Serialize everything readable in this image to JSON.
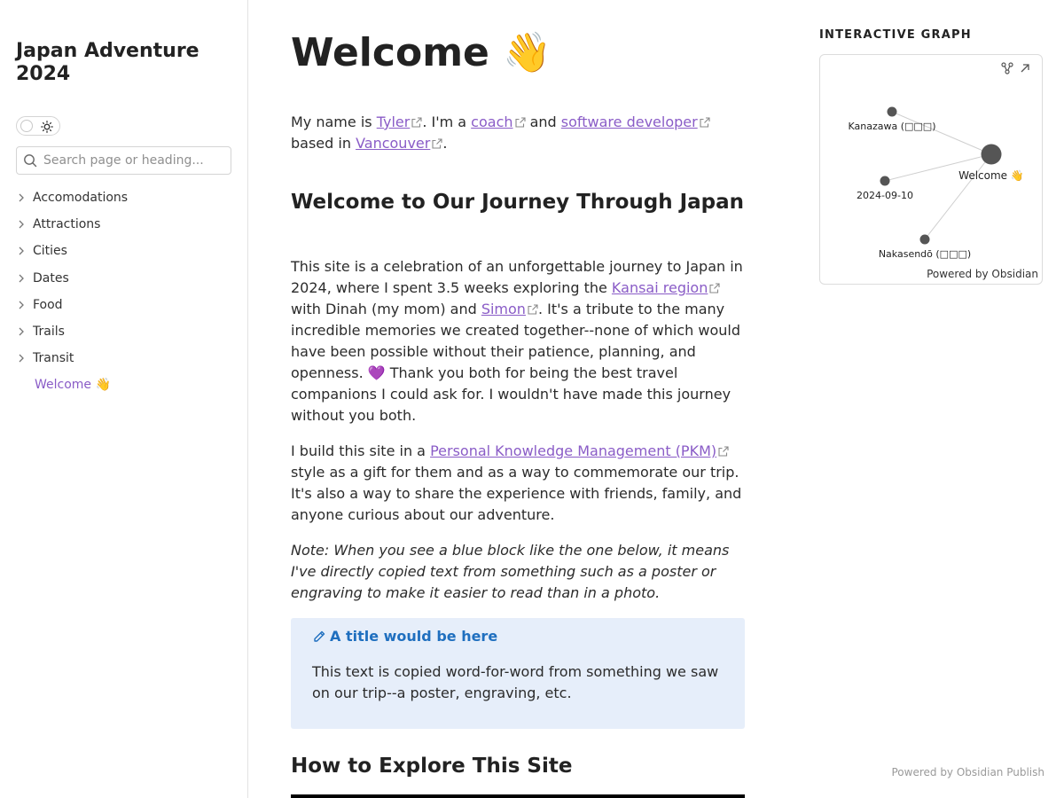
{
  "site": {
    "title": "Japan Adventure 2024"
  },
  "search": {
    "placeholder": "Search page or heading..."
  },
  "sidebar": {
    "items": [
      {
        "label": "Accomodations",
        "icon": "chevron-right-icon"
      },
      {
        "label": "Attractions",
        "icon": "chevron-right-icon"
      },
      {
        "label": "Cities",
        "icon": "chevron-right-icon"
      },
      {
        "label": "Dates",
        "icon": "chevron-right-icon"
      },
      {
        "label": "Food",
        "icon": "chevron-right-icon"
      },
      {
        "label": "Trails",
        "icon": "chevron-right-icon"
      },
      {
        "label": "Transit",
        "icon": "chevron-right-icon"
      }
    ],
    "active_item": "Welcome 👋"
  },
  "page": {
    "title": "Welcome 👋",
    "intro": {
      "t1": "My name is ",
      "l1": "Tyler",
      "t2": ". I'm a ",
      "l2": "coach",
      "t3": " and ",
      "l3": "software developer",
      "t4": " based in ",
      "l4": "Vancouver",
      "t5": "."
    },
    "section1_title": "Welcome to Our Journey Through Japan",
    "para1": {
      "t1": "This site is a celebration of an unforgettable journey to Japan in 2024, where I spent 3.5 weeks exploring the ",
      "l1": "Kansai region",
      "t2": " with Dinah (my mom) and ",
      "l2": "Simon",
      "t3": ". It's a tribute to the many incredible memories we created together--none of which would have been possible without their patience, planning, and openness. 💜 Thank you both for being the best travel companions I could ask for. I wouldn't have made this journey without you both."
    },
    "para2": {
      "t1": "I build this site in a ",
      "l1": "Personal Knowledge Management (PKM)",
      "t2": " style as a gift for them and as a way to commemorate our trip. It's also a way to share the experience with friends, family, and anyone curious about our adventure."
    },
    "note": "Note: When you see a blue block like the one below, it means I've directly copied text from something such as a poster or engraving to make it easier to read than in a photo.",
    "callout": {
      "title": "A title would be here",
      "body": "This text is copied word-for-word from something we saw on our trip--a poster, engraving, etc.",
      "icon": "pencil-icon"
    },
    "section2_title": "How to Explore This Site"
  },
  "graph": {
    "heading": "INTERACTIVE GRAPH",
    "nodes": {
      "kanazawa": "Kanazawa (□□□)",
      "date": "2024-09-10",
      "welcome": "Welcome 👋",
      "nakasendo": "Nakasendō (□□□)"
    },
    "powered": "Powered by Obsidian"
  },
  "footer": {
    "powered": "Powered by Obsidian Publish"
  },
  "colors": {
    "link": "#8a5cc7",
    "callout_bg": "#e6eefa",
    "callout_title": "#1f6fbf"
  }
}
